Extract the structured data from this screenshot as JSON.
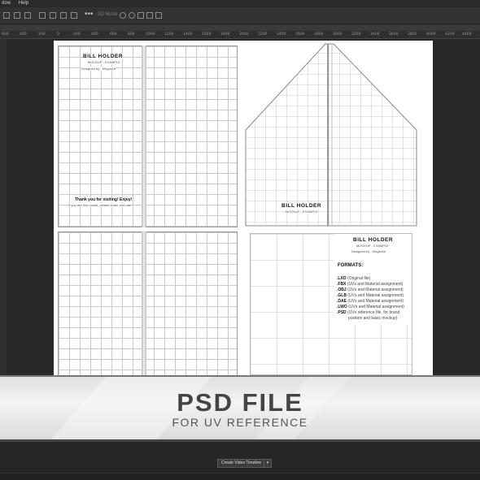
{
  "menu": {
    "items": [
      "dow",
      "Help"
    ]
  },
  "options": {
    "mode_label": "3D Mode:",
    "more": "•••"
  },
  "ruler": {
    "ticks": [
      "600",
      "400",
      "200",
      "0",
      "200",
      "400",
      "600",
      "800",
      "1000",
      "1200",
      "1400",
      "1600",
      "1800",
      "2000",
      "2200",
      "2400",
      "2600",
      "2800",
      "3000",
      "3200",
      "3400",
      "3600",
      "3800",
      "4000",
      "4200",
      "4400"
    ]
  },
  "doc": {
    "front_title": "BILL HOLDER",
    "front_sub": "MOCKUP - EXAMPLE",
    "front_designer": "Designed by - MogerArt",
    "thanks": "Thank you for visiting! Enjoy!",
    "thanks_sub": "If you like this model, please share and rate",
    "flap_title": "BILL HOLDER",
    "flap_sub": "MOCKUP - EXAMPLE",
    "info_title": "BILL HOLDER",
    "info_sub": "MOCKUP - EXAMPLE",
    "info_designer": "Designed by - MogerArt",
    "formats_label": "FORMATS:",
    "formats": [
      {
        "ext": ".LXO",
        "desc": "(Original file)"
      },
      {
        "ext": ".FBX",
        "desc": "(UVs and Material assignment)"
      },
      {
        "ext": ".OBJ",
        "desc": "(UVs and Material assignment)"
      },
      {
        "ext": ".GLB",
        "desc": "(UVs and Material assignment)"
      },
      {
        "ext": ".DAE",
        "desc": "(UVs and Material assignment)"
      },
      {
        "ext": ".LWO",
        "desc": "(UVs and Material assignment)"
      },
      {
        "ext": ".PSD",
        "desc": "(UVs reference file, for brand"
      },
      {
        "ext": "",
        "desc": "position and basic mockup)"
      }
    ]
  },
  "banner": {
    "title": "PSD FILE",
    "subtitle": "FOR UV REFERENCE"
  },
  "timeline": {
    "create_label": "Create Video Timeline",
    "caret": "▾"
  }
}
